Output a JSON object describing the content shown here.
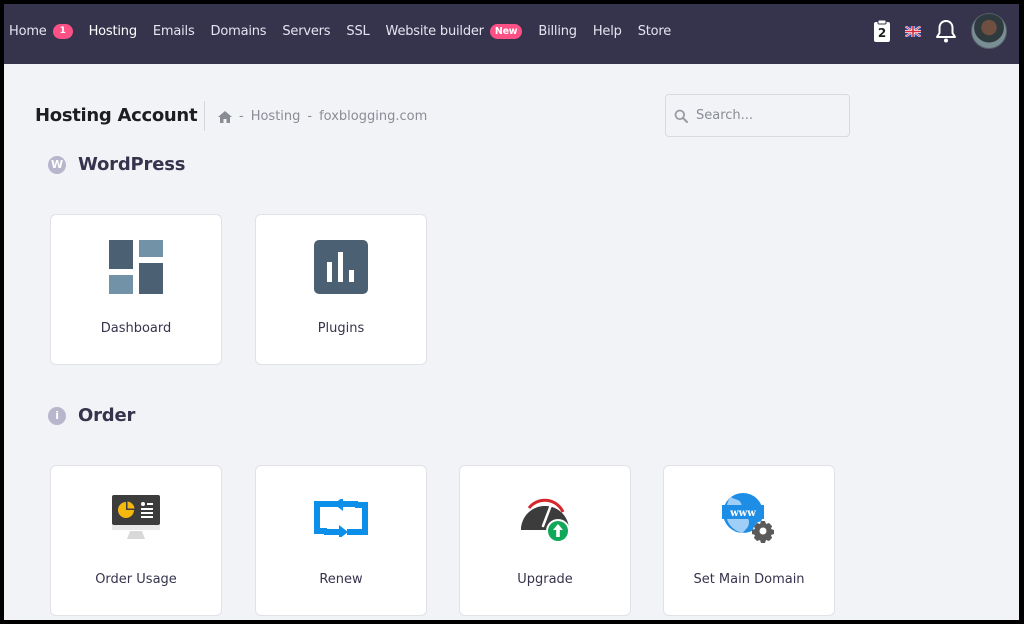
{
  "topbar": {
    "nav": [
      {
        "label": "Home",
        "badge": "1"
      },
      {
        "label": "Hosting"
      },
      {
        "label": "Emails"
      },
      {
        "label": "Domains"
      },
      {
        "label": "Servers"
      },
      {
        "label": "SSL"
      },
      {
        "label": "Website builder",
        "badge": "New"
      },
      {
        "label": "Billing"
      },
      {
        "label": "Help"
      },
      {
        "label": "Store"
      }
    ],
    "tools": {
      "clipboard_count": "2",
      "language_icon": "uk-flag-icon",
      "notifications_icon": "bell-icon",
      "avatar_icon": "user-avatar"
    }
  },
  "header": {
    "title": "Hosting Account",
    "breadcrumb": {
      "home_icon": "home-icon",
      "sep": "-",
      "items": [
        "Hosting",
        "foxblogging.com"
      ]
    },
    "search": {
      "placeholder": "Search...",
      "value": ""
    }
  },
  "sections": [
    {
      "title": "WordPress",
      "icon": "wordpress-icon",
      "cards": [
        {
          "label": "Dashboard",
          "icon": "dashboard-icon"
        },
        {
          "label": "Plugins",
          "icon": "plugins-icon"
        }
      ]
    },
    {
      "title": "Order",
      "icon": "info-icon",
      "cards": [
        {
          "label": "Order Usage",
          "icon": "order-usage-icon"
        },
        {
          "label": "Renew",
          "icon": "renew-icon"
        },
        {
          "label": "Upgrade",
          "icon": "upgrade-icon"
        },
        {
          "label": "Set Main Domain",
          "icon": "set-main-domain-icon"
        }
      ]
    }
  ],
  "colors": {
    "topbar_bg": "#36344d",
    "badge": "#fc5185",
    "page_bg": "#f2f3f7",
    "renew_blue": "#0b8fe8",
    "upgrade_green": "#11a85a"
  }
}
